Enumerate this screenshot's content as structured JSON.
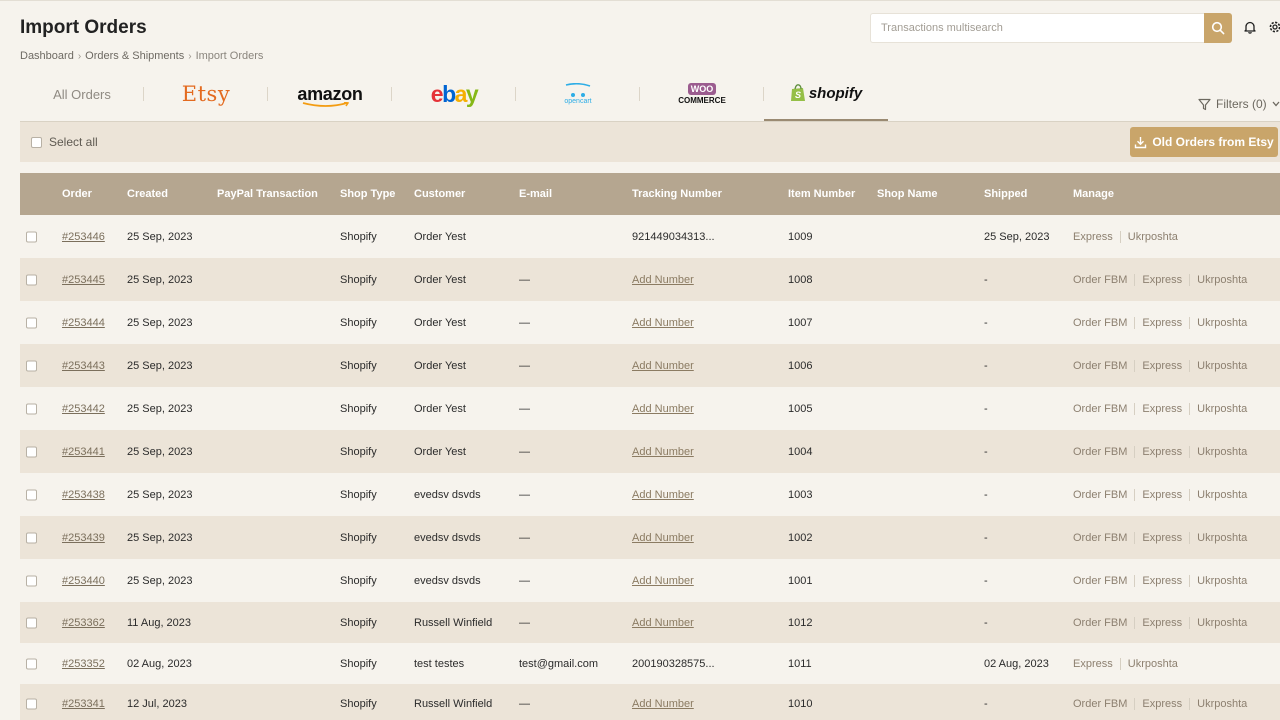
{
  "page": {
    "title": "Import Orders",
    "breadcrumb": [
      "Dashboard",
      "Orders & Shipments",
      "Import Orders"
    ]
  },
  "search": {
    "placeholder": "Transactions multisearch",
    "icon": "search-icon"
  },
  "header_icons": [
    "bell-icon",
    "gear-icon"
  ],
  "shop_tabs": {
    "all": "All Orders",
    "etsy": "Etsy",
    "amazon": "amazon",
    "ebay": "ebay",
    "opencart": "opencart",
    "woo_top": "WOO",
    "woo_bottom": "COMMERCE",
    "shopify": "shopify",
    "active": "shopify"
  },
  "filters": {
    "label": "Filters (0)"
  },
  "toolbar": {
    "select_all": "Select all",
    "old_orders_button": "Old Orders from Etsy"
  },
  "table": {
    "headers": {
      "order": "Order",
      "created": "Created",
      "paypal": "PayPal Transaction",
      "shop_type": "Shop Type",
      "customer": "Customer",
      "email": "E-mail",
      "tracking": "Tracking Number",
      "item": "Item Number",
      "shop_name": "Shop Name",
      "shipped": "Shipped",
      "manage": "Manage"
    },
    "rows": [
      {
        "order": "#253446",
        "created": "25 Sep, 2023",
        "shop_type": "Shopify",
        "customer": "Order Yest",
        "email": "",
        "tracking": "921449034313...",
        "tracking_is_link": false,
        "item": "1009",
        "shipped": "25 Sep, 2023",
        "manage": [
          "Express",
          "Ukrposhta"
        ]
      },
      {
        "order": "#253445",
        "created": "25 Sep, 2023",
        "shop_type": "Shopify",
        "customer": "Order Yest",
        "email": "—",
        "tracking": "Add Number",
        "tracking_is_link": true,
        "item": "1008",
        "shipped": "-",
        "manage": [
          "Order FBM",
          "Express",
          "Ukrposhta"
        ]
      },
      {
        "order": "#253444",
        "created": "25 Sep, 2023",
        "shop_type": "Shopify",
        "customer": "Order Yest",
        "email": "—",
        "tracking": "Add Number",
        "tracking_is_link": true,
        "item": "1007",
        "shipped": "-",
        "manage": [
          "Order FBM",
          "Express",
          "Ukrposhta"
        ]
      },
      {
        "order": "#253443",
        "created": "25 Sep, 2023",
        "shop_type": "Shopify",
        "customer": "Order Yest",
        "email": "—",
        "tracking": "Add Number",
        "tracking_is_link": true,
        "item": "1006",
        "shipped": "-",
        "manage": [
          "Order FBM",
          "Express",
          "Ukrposhta"
        ]
      },
      {
        "order": "#253442",
        "created": "25 Sep, 2023",
        "shop_type": "Shopify",
        "customer": "Order Yest",
        "email": "—",
        "tracking": "Add Number",
        "tracking_is_link": true,
        "item": "1005",
        "shipped": "-",
        "manage": [
          "Order FBM",
          "Express",
          "Ukrposhta"
        ]
      },
      {
        "order": "#253441",
        "created": "25 Sep, 2023",
        "shop_type": "Shopify",
        "customer": "Order Yest",
        "email": "—",
        "tracking": "Add Number",
        "tracking_is_link": true,
        "item": "1004",
        "shipped": "-",
        "manage": [
          "Order FBM",
          "Express",
          "Ukrposhta"
        ]
      },
      {
        "order": "#253438",
        "created": "25 Sep, 2023",
        "shop_type": "Shopify",
        "customer": "evedsv dsvds",
        "email": "—",
        "tracking": "Add Number",
        "tracking_is_link": true,
        "item": "1003",
        "shipped": "-",
        "manage": [
          "Order FBM",
          "Express",
          "Ukrposhta"
        ]
      },
      {
        "order": "#253439",
        "created": "25 Sep, 2023",
        "shop_type": "Shopify",
        "customer": "evedsv dsvds",
        "email": "—",
        "tracking": "Add Number",
        "tracking_is_link": true,
        "item": "1002",
        "shipped": "-",
        "manage": [
          "Order FBM",
          "Express",
          "Ukrposhta"
        ]
      },
      {
        "order": "#253440",
        "created": "25 Sep, 2023",
        "shop_type": "Shopify",
        "customer": "evedsv dsvds",
        "email": "—",
        "tracking": "Add Number",
        "tracking_is_link": true,
        "item": "1001",
        "shipped": "-",
        "manage": [
          "Order FBM",
          "Express",
          "Ukrposhta"
        ]
      },
      {
        "order": "#253362",
        "created": "11 Aug, 2023",
        "shop_type": "Shopify",
        "customer": "Russell Winfield",
        "email": "—",
        "tracking": "Add Number",
        "tracking_is_link": true,
        "item": "1012",
        "shipped": "-",
        "manage": [
          "Order FBM",
          "Express",
          "Ukrposhta"
        ]
      },
      {
        "order": "#253352",
        "created": "02 Aug, 2023",
        "shop_type": "Shopify",
        "customer": "test testes",
        "email": "test@gmail.com",
        "tracking": "200190328575...",
        "tracking_is_link": false,
        "item": "1011",
        "shipped": "02 Aug, 2023",
        "manage": [
          "Express",
          "Ukrposhta"
        ]
      },
      {
        "order": "#253341",
        "created": "12 Jul, 2023",
        "shop_type": "Shopify",
        "customer": "Russell Winfield",
        "email": "—",
        "tracking": "Add Number",
        "tracking_is_link": true,
        "item": "1010",
        "shipped": "-",
        "manage": [
          "Order FBM",
          "Express",
          "Ukrposhta"
        ]
      }
    ]
  }
}
